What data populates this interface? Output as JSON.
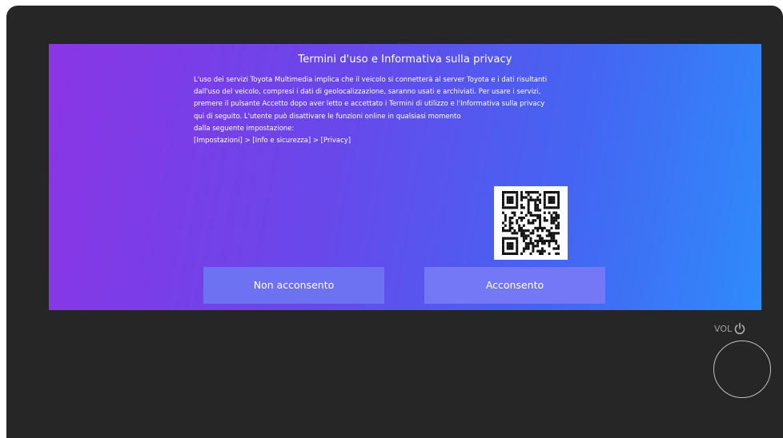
{
  "dialog": {
    "title": "Termini d'uso e Informativa sulla privacy",
    "body_lines": [
      "L'uso dei servizi Toyota Multimedia implica che il veicolo si connetterà al server Toyota e i dati risultanti",
      "dall'uso del veicolo, compresi i dati di geolocalizzazione, saranno usati e archiviati. Per usare i servizi,",
      "premere il pulsante Accetto dopo aver letto e accettato i Termini di utilizzo e l'Informativa sulla privacy",
      "qui di seguito. L'utente può disattivare le funzioni online in qualsiasi momento",
      "dalla seguente impostazione:",
      "[Impostazioni] > [Info e sicurezza] > [Privacy]"
    ],
    "decline_label": "Non acconsento",
    "accept_label": "Acconsento"
  },
  "hardware": {
    "vol_label": "VOL",
    "power_icon": "power-icon"
  },
  "colors": {
    "gradient_start": "#8a35e6",
    "gradient_end": "#2f8bfa",
    "button": "#7478f6",
    "bezel": "#262626"
  }
}
